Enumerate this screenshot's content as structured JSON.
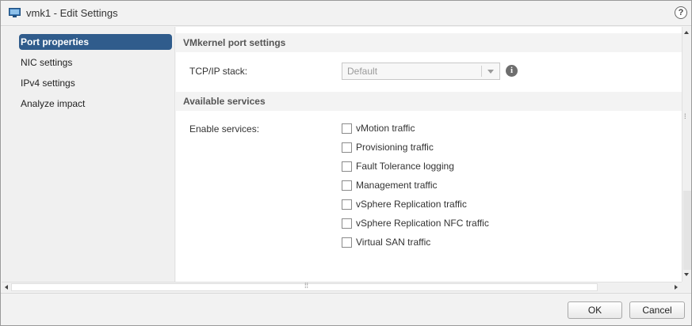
{
  "window": {
    "title": "vmk1 - Edit Settings",
    "icon": "vm-network-adapter-icon",
    "help_icon": "?"
  },
  "nav": {
    "items": [
      {
        "label": "Port properties",
        "active": true
      },
      {
        "label": "NIC settings",
        "active": false
      },
      {
        "label": "IPv4 settings",
        "active": false
      },
      {
        "label": "Analyze impact",
        "active": false
      }
    ]
  },
  "port_settings": {
    "header": "VMkernel port settings",
    "tcpip_label": "TCP/IP stack:",
    "tcpip_value": "Default",
    "info_icon": "i"
  },
  "services": {
    "header": "Available services",
    "enable_label": "Enable services:",
    "options": [
      {
        "label": "vMotion traffic",
        "checked": false
      },
      {
        "label": "Provisioning traffic",
        "checked": false
      },
      {
        "label": "Fault Tolerance logging",
        "checked": false
      },
      {
        "label": "Management traffic",
        "checked": false
      },
      {
        "label": "vSphere Replication traffic",
        "checked": false
      },
      {
        "label": "vSphere Replication NFC traffic",
        "checked": false
      },
      {
        "label": "Virtual SAN traffic",
        "checked": false
      }
    ]
  },
  "footer": {
    "ok_label": "OK",
    "cancel_label": "Cancel"
  },
  "colors": {
    "nav_active": "#305c8c",
    "section_header_bg": "#f3f3f3",
    "dialog_bg": "#f2f2f2"
  }
}
